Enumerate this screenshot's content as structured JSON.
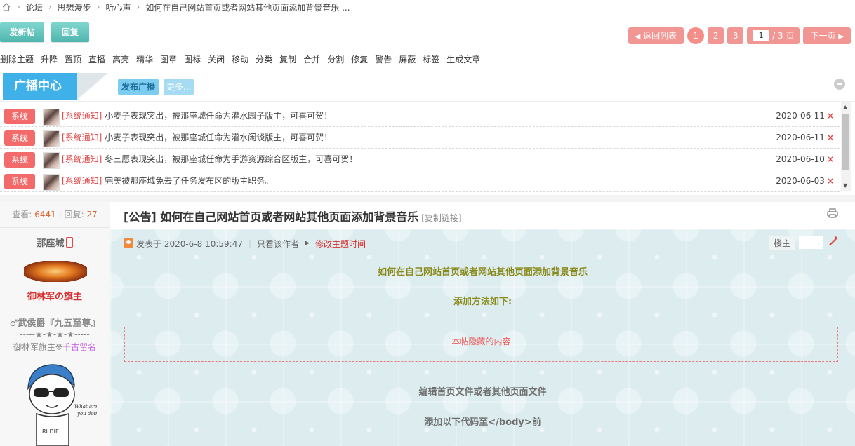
{
  "breadcrumb": {
    "items": [
      "论坛",
      "思想漫步",
      "听心声"
    ],
    "current": "如何在自己网站首页或者网站其他页面添加背景音乐 ..."
  },
  "actions": {
    "post": "发新帖",
    "reply": "回复"
  },
  "pager": {
    "back": "返回列表",
    "pages": [
      "1",
      "2",
      "3"
    ],
    "current_input": "1",
    "total": "/ 3 页",
    "next": "下一页"
  },
  "mod_tools": [
    "删除主题",
    "升降",
    "置顶",
    "直播",
    "高亮",
    "精华",
    "图章",
    "图标",
    "关闭",
    "移动",
    "分类",
    "复制",
    "合并",
    "分割",
    "修复",
    "警告",
    "屏蔽",
    "标签",
    "生成文章"
  ],
  "broadcast": {
    "title": "广播中心",
    "publish": "发布广播",
    "more": "更多...",
    "items": [
      {
        "tag": "系统",
        "notice": "[系统通知]",
        "text": " 小麦子表现突出，被那座城任命为灌水园子版主，可喜可贺！",
        "date": "2020-06-11"
      },
      {
        "tag": "系统",
        "notice": "[系统通知]",
        "text": " 小麦子表现突出，被那座城任命为灌水闲谈版主，可喜可贺！",
        "date": "2020-06-11"
      },
      {
        "tag": "系统",
        "notice": "[系统通知]",
        "text": " 冬三愿表现突出，被那座城任命为手游资源综合区版主，可喜可贺！",
        "date": "2020-06-10"
      },
      {
        "tag": "系统",
        "notice": "[系统通知]",
        "text": " 完美被那座城免去了任务发布区的版主职务。",
        "date": "2020-06-03"
      }
    ],
    "close_mark": "×"
  },
  "stats": {
    "views_label": "查看:",
    "views": "6441",
    "replies_label": "回复:",
    "replies": "27"
  },
  "author": {
    "name": "那座城",
    "medal_title": "御林军の旗主",
    "rank": "♂武侯爵『九五至尊』",
    "stars": "-----★-★-★-★-----",
    "title_prefix": "御林军旗主❊",
    "title_suffix": "千古留名"
  },
  "post": {
    "title": "[公告] 如何在自己网站首页或者网站其他页面添加背景音乐",
    "copy_link": "[复制链接]",
    "posted_at": "发表于 2020-6-8 10:59:47",
    "only_author": "只看该作者",
    "edit_time": "修改主题时间",
    "floor": "楼主",
    "lines": [
      "如何在自己网站首页或者网站其他页面添加背景音乐",
      "添加方法如下:",
      "编辑首页文件或者其他页面文件",
      "添加以下代码至</body>前"
    ],
    "hidden_notice": "本帖隐藏的内容"
  },
  "colors": {
    "pager": "#f29693",
    "tag": "#f26a6a",
    "broadcast_tab": "#3fb1e8",
    "green_btn": "#4fb6ae",
    "olive_text": "#8a8a1a",
    "gray_text": "#6f6f6f"
  }
}
